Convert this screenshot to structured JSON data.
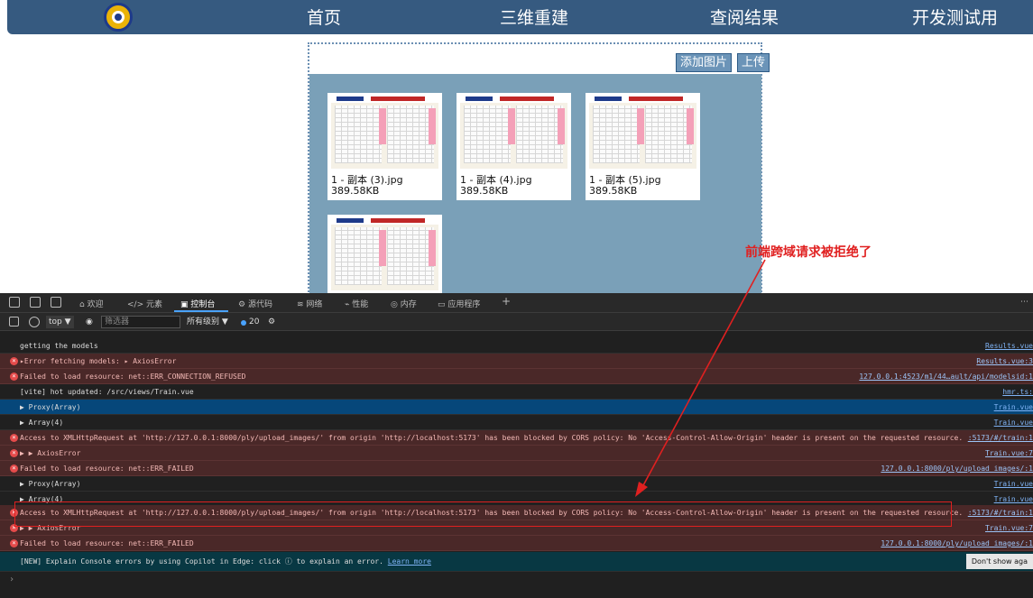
{
  "nav": {
    "items": [
      "首页",
      "三维重建",
      "查阅结果",
      "开发测试用"
    ]
  },
  "upload": {
    "add_label": "添加图片",
    "upload_label": "上传",
    "cards": [
      {
        "name": "1 - 副本 (3).jpg",
        "size": "389.58KB"
      },
      {
        "name": "1 - 副本 (4).jpg",
        "size": "389.58KB"
      },
      {
        "name": "1 - 副本 (5).jpg",
        "size": "389.58KB"
      }
    ]
  },
  "annotation": "前端跨域请求被拒绝了",
  "devtools": {
    "tabs": [
      "欢迎",
      "元素",
      "控制台",
      "源代码",
      "网络",
      "性能",
      "内存",
      "应用程序"
    ],
    "context": "top ▼",
    "filter_placeholder": "筛选器",
    "levels": "所有级别 ▼",
    "issue_count": "20",
    "logs": [
      {
        "type": "info",
        "msg": "getting the models",
        "src": "Results.vue"
      },
      {
        "type": "err",
        "msg": "▸Error fetching models: ▸ AxiosError",
        "src": "Results.vue:3"
      },
      {
        "type": "err",
        "msg": "Failed to load resource: net::ERR_CONNECTION_REFUSED",
        "src": "127.0.0.1:4523/m1/44…ault/api/modelsid:1"
      },
      {
        "type": "info",
        "msg": "[vite] hot updated: /src/views/Train.vue",
        "src": "hmr.ts:"
      },
      {
        "type": "selected",
        "msg": "▶ Proxy(Array)",
        "src": "Train.vue"
      },
      {
        "type": "info",
        "msg": "▶ Array(4)",
        "src": "Train.vue"
      },
      {
        "type": "err",
        "msg": "Access to XMLHttpRequest at 'http://127.0.0.1:8000/ply/upload_images/' from origin 'http://localhost:5173' has been blocked by CORS policy: No 'Access-Control-Allow-Origin' header is present on the requested resource.",
        "src": ":5173/#/train:1"
      },
      {
        "type": "err",
        "msg": "▶ ▶ AxiosError",
        "src": "Train.vue:7"
      },
      {
        "type": "err",
        "msg": "Failed to load resource: net::ERR_FAILED",
        "src": "127.0.0.1:8000/ply/upload_images/:1"
      },
      {
        "type": "info",
        "msg": "▶ Proxy(Array)",
        "src": "Train.vue"
      },
      {
        "type": "info",
        "msg": "▶ Array(4)",
        "src": "Train.vue"
      },
      {
        "type": "err",
        "msg": "Access to XMLHttpRequest at 'http://127.0.0.1:8000/ply/upload_images/' from origin 'http://localhost:5173' has been blocked by CORS policy: No 'Access-Control-Allow-Origin' header is present on the requested resource.",
        "src": ":5173/#/train:1"
      },
      {
        "type": "err",
        "msg": "▶ ▶ AxiosError",
        "src": "Train.vue:7"
      },
      {
        "type": "err",
        "msg": "Failed to load resource: net::ERR_FAILED",
        "src": "127.0.0.1:8000/ply/upload_images/:1"
      }
    ],
    "copilot": "[NEW] Explain Console errors by using Copilot in Edge: click ⓘ to explain an error.",
    "copilot_link": "Learn more",
    "dismiss": "Don't show aga"
  }
}
